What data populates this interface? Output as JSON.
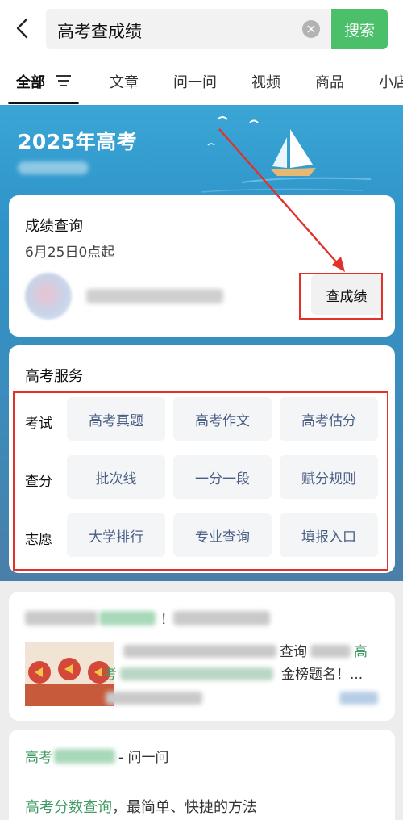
{
  "search": {
    "query": "高考查成绩",
    "clear_glyph": "×",
    "button_label": "搜索"
  },
  "tabs": [
    {
      "label": "全部"
    },
    {
      "label": "文章"
    },
    {
      "label": "问一问"
    },
    {
      "label": "视频"
    },
    {
      "label": "商品"
    },
    {
      "label": "小店"
    }
  ],
  "banner": {
    "title": "2025年高考"
  },
  "score_card": {
    "title": "成绩查询",
    "date": "6月25日0点起",
    "button_label": "查成绩"
  },
  "service_card": {
    "title": "高考服务",
    "rows": [
      {
        "label": "考试",
        "items": [
          "高考真题",
          "高考作文",
          "高考估分"
        ]
      },
      {
        "label": "查分",
        "items": [
          "批次线",
          "一分一段",
          "赋分规则"
        ]
      },
      {
        "label": "志愿",
        "items": [
          "大学排行",
          "专业查询",
          "填报入口"
        ]
      }
    ]
  },
  "result_1": {
    "title_tail": "！",
    "snippet_line1_tail": "查询",
    "snippet_line1_end": "高",
    "snippet_line2_head": "考",
    "snippet_line2_tail": "金榜题名！..."
  },
  "result_2": {
    "title_head": "高考",
    "title_tail": "- 问一问",
    "snippet_green": "高考分数查询",
    "snippet_rest": "，最简单、快捷的方法"
  },
  "colors": {
    "accent_green": "#4cbf6b",
    "highlight_red": "#e0312b",
    "service_text": "#4a5f85"
  }
}
